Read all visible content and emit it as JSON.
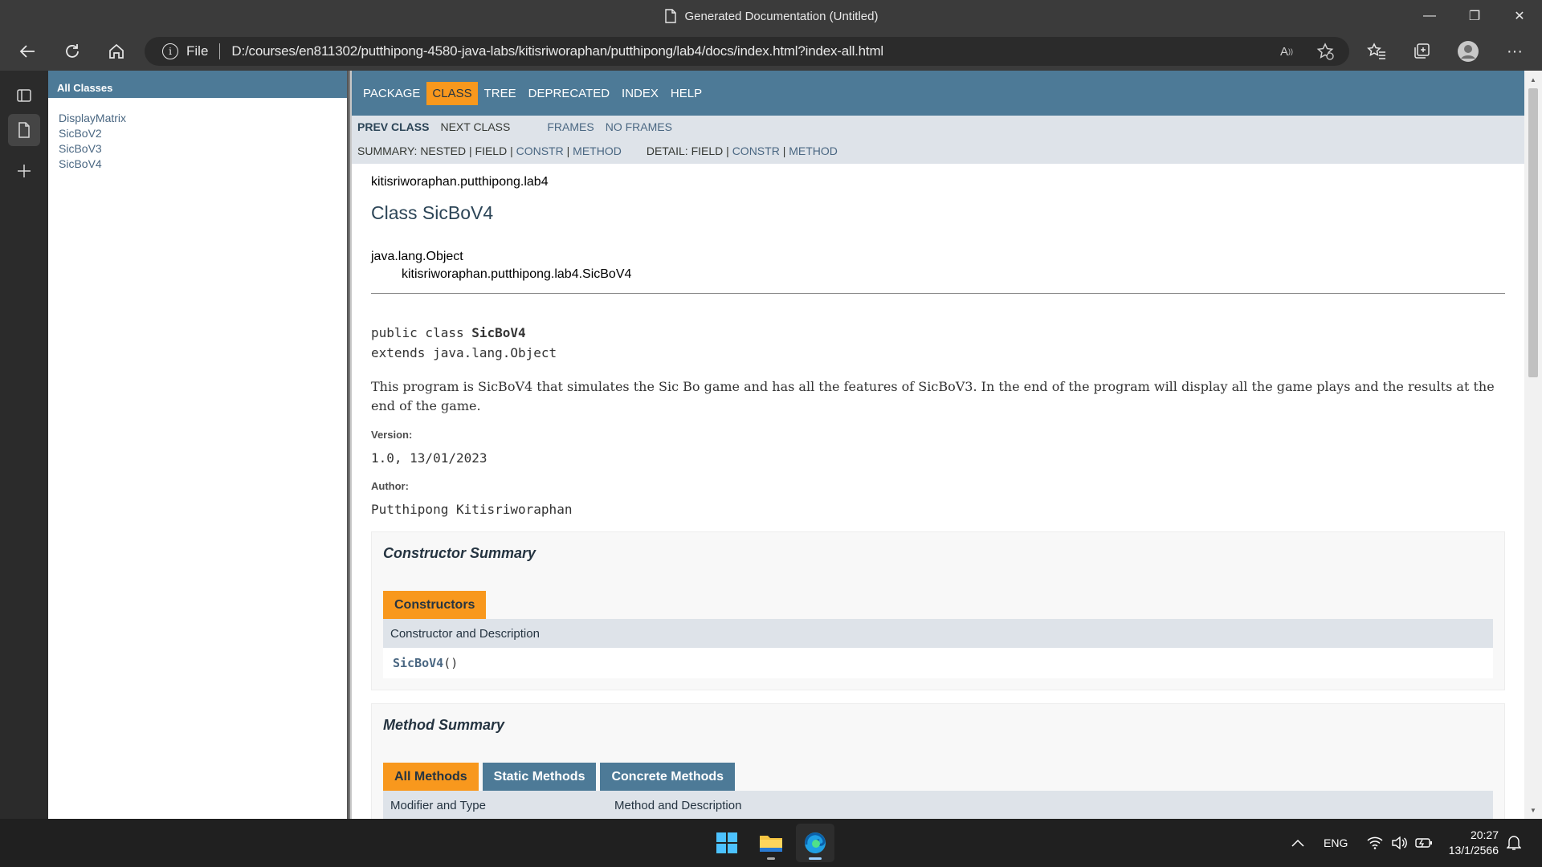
{
  "window": {
    "title": "Generated Documentation (Untitled)",
    "minimize_label": "—",
    "maximize_label": "❐",
    "close_label": "✕"
  },
  "address_bar": {
    "scheme_label": "File",
    "url": "D:/courses/en811302/putthipong-4580-java-labs/kitisriworaphan/putthipong/lab4/docs/index.html?index-all.html",
    "read_aloud_label": "A"
  },
  "all_classes": {
    "header": "All Classes",
    "items": [
      "DisplayMatrix",
      "SicBoV2",
      "SicBoV3",
      "SicBoV4"
    ]
  },
  "nav": {
    "items": [
      "PACKAGE",
      "CLASS",
      "TREE",
      "DEPRECATED",
      "INDEX",
      "HELP"
    ],
    "active": "CLASS",
    "prev_class": "PREV CLASS",
    "next_class": "NEXT CLASS",
    "frames": "FRAMES",
    "no_frames": "NO FRAMES",
    "summary_prefix": "SUMMARY: NESTED | FIELD | ",
    "summary_constr": "CONSTR",
    "summary_sep": " | ",
    "summary_method": "METHOD",
    "detail_prefix": "DETAIL: FIELD | ",
    "detail_constr": "CONSTR",
    "detail_sep": " | ",
    "detail_method": "METHOD"
  },
  "doc": {
    "package": "kitisriworaphan.putthipong.lab4",
    "class_title": "Class SicBoV4",
    "inherit_root": "java.lang.Object",
    "inherit_class": "kitisriworaphan.putthipong.lab4.SicBoV4",
    "decl_prefix": "public class ",
    "decl_name": "SicBoV4",
    "decl_extends": "extends java.lang.Object",
    "description": "This program is SicBoV4 that simulates the Sic Bo game and has all the features of SicBoV3. In the end of the program will display all the game plays and the results at the end of the game.",
    "version_label": "Version:",
    "version_value": "1.0, 13/01/2023",
    "author_label": "Author:",
    "author_value": "Putthipong Kitisriworaphan"
  },
  "constructor_summary": {
    "title": "Constructor Summary",
    "tab": "Constructors",
    "column": "Constructor and Description",
    "row_name": "SicBoV4",
    "row_suffix": "()"
  },
  "method_summary": {
    "title": "Method Summary",
    "tabs": [
      "All Methods",
      "Static Methods",
      "Concrete Methods"
    ],
    "columns": [
      "Modifier and Type",
      "Method and Description"
    ]
  },
  "taskbar": {
    "language": "ENG",
    "time": "20:27",
    "date": "13/1/2566"
  },
  "colors": {
    "nav_blue": "#4d7a97",
    "active_orange": "#f8981d",
    "subnav_gray": "#dee3e9",
    "link_blue": "#4a6782"
  }
}
